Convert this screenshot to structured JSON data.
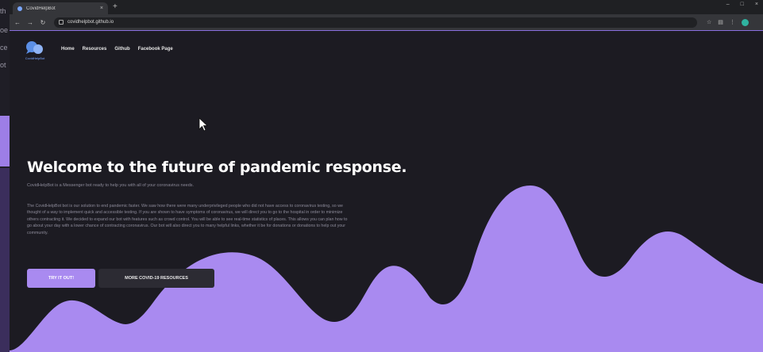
{
  "bleed": {
    "lines": [
      "th",
      "oe",
      "ce",
      "ot"
    ]
  },
  "browser": {
    "tab_title": "CovidHelpBot",
    "tab_close": "×",
    "new_tab": "+",
    "window_controls": [
      "–",
      "□",
      "×"
    ],
    "url": "covidhelpbot.github.io",
    "nav_icons": [
      "arrow-left-icon",
      "arrow-right-icon",
      "reload-icon"
    ],
    "toolbar_icons": [
      "star-icon",
      "extensions-icon",
      "menu-icon"
    ]
  },
  "site": {
    "brand_name": "CovidHelpBot",
    "nav": [
      "Home",
      "Resources",
      "Github",
      "Facebook Page"
    ],
    "accent_color": "#a98af0",
    "background_color": "#1c1b22"
  },
  "hero": {
    "title": "Welcome to the future of pandemic response.",
    "subtitle": "CovidHelpBot is a Messenger bot ready to help you with all of your coronavirus needs.",
    "paragraph": "The CovidHelpBot bot is our solution to end pandemic faster. We saw how there were many underprivileged people who did not have access to coronavirus testing, so we thought of a way to implement quick and accessible testing. If you are shown to have symptoms of coronavirus, we will direct you to go to the hospital in order to minimize others contracting it. We decided to expand our bot with features such as crowd control. You will be able to see real-time statistics of places. This allows you can plan how to go about your day with a lower chance of contracting coronavirus. Our bot will also direct you to many helpful links, whether it be for donations or donations to help out your community.",
    "primary_button": "TRY IT OUT!",
    "secondary_button": "MORE COVID-19 RESOURCES"
  }
}
